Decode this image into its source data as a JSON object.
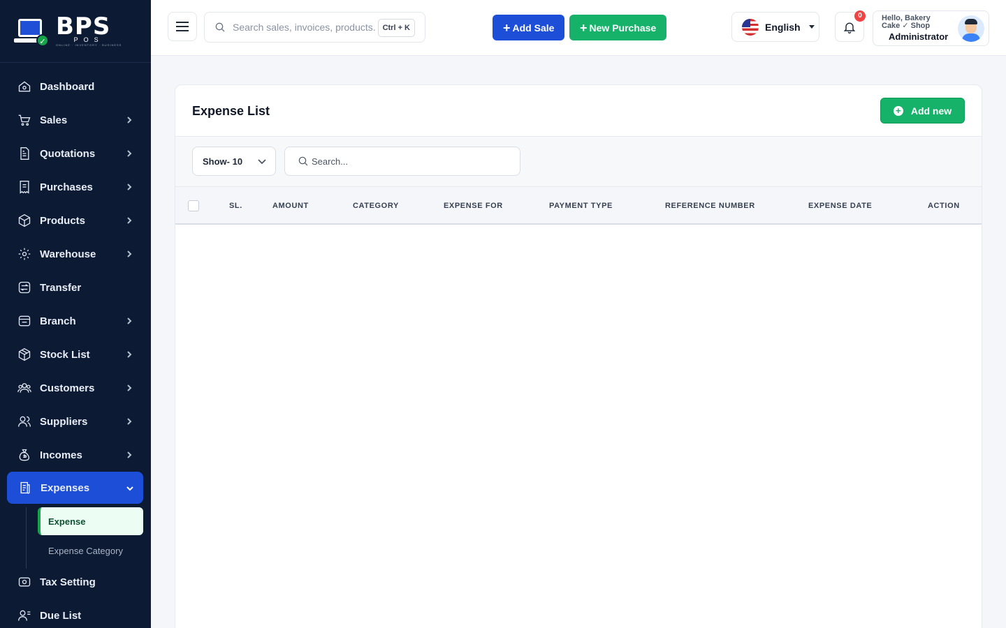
{
  "brand": {
    "name": "BPS",
    "sub": "POS",
    "tagline": "ONLINE · INVENTORY · BUSINESS"
  },
  "sidebar": {
    "items": [
      {
        "label": "Dashboard",
        "icon": "home-icon",
        "chevron": false
      },
      {
        "label": "Sales",
        "icon": "cart-icon",
        "chevron": true
      },
      {
        "label": "Quotations",
        "icon": "document-icon",
        "chevron": true
      },
      {
        "label": "Purchases",
        "icon": "receipt-icon",
        "chevron": true
      },
      {
        "label": "Products",
        "icon": "box-icon",
        "chevron": true
      },
      {
        "label": "Warehouse",
        "icon": "warehouse-icon",
        "chevron": true
      },
      {
        "label": "Transfer",
        "icon": "transfer-icon",
        "chevron": false
      },
      {
        "label": "Branch",
        "icon": "branch-icon",
        "chevron": true
      },
      {
        "label": "Stock List",
        "icon": "cube-icon",
        "chevron": true
      },
      {
        "label": "Customers",
        "icon": "users-icon",
        "chevron": true
      },
      {
        "label": "Suppliers",
        "icon": "user-group-icon",
        "chevron": true
      },
      {
        "label": "Incomes",
        "icon": "money-bag-icon",
        "chevron": true
      },
      {
        "label": "Expenses",
        "icon": "expense-icon",
        "chevron": true,
        "active": true
      },
      {
        "label": "Tax Setting",
        "icon": "tax-icon",
        "chevron": false
      },
      {
        "label": "Due List",
        "icon": "due-list-icon",
        "chevron": false
      }
    ],
    "expenses_sub": [
      {
        "label": "Expense",
        "active": true
      },
      {
        "label": "Expense Category"
      }
    ]
  },
  "header": {
    "search_placeholder": "Search sales, invoices, products...",
    "shortcut": "Ctrl + K",
    "add_sale": "Add Sale",
    "new_purchase": "New Purchase",
    "language": "English",
    "notification_count": "0",
    "greeting": "Hello, Bakery Cake ✓ Shop",
    "role": "Administrator"
  },
  "page": {
    "title": "Expense List",
    "add_new": "Add new",
    "show": "Show- 10",
    "search_placeholder": "Search...",
    "columns": [
      "SL.",
      "AMOUNT",
      "CATEGORY",
      "EXPENSE FOR",
      "PAYMENT TYPE",
      "REFERENCE NUMBER",
      "EXPENSE DATE",
      "ACTION"
    ]
  },
  "colors": {
    "sidebar": "#0c1a33",
    "primary": "#1d4ed8",
    "success": "#16b26a",
    "danger": "#ef4444"
  }
}
